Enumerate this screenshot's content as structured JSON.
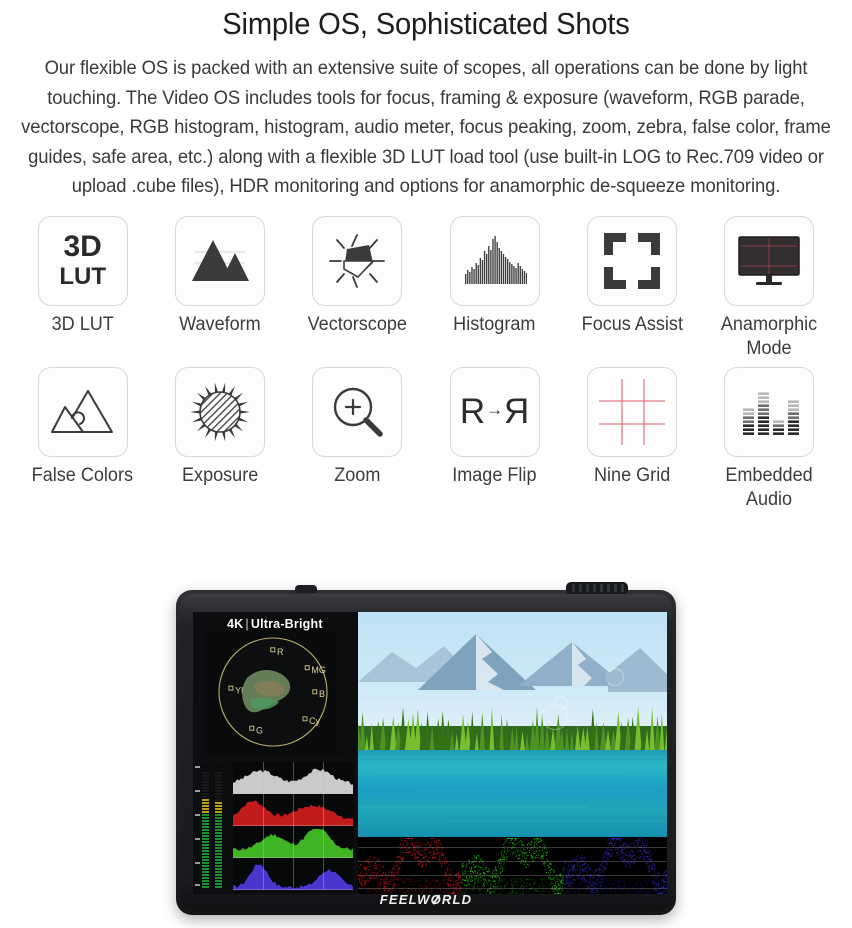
{
  "headline": "Simple OS, Sophisticated Shots",
  "intro": "Our flexible OS is packed with an extensive suite of scopes, all operations can be done by light touching. The Video OS includes tools for focus, framing & exposure (waveform, RGB parade, vectorscope, RGB histogram, histogram, audio meter, focus peaking, zoom, zebra, false color, frame guides, safe area, etc.) along with a flexible 3D LUT load tool (use built-in LOG to Rec.709 video or upload .cube files), HDR monitoring and options for anamorphic de-squeeze monitoring.",
  "features": [
    {
      "label": "3D LUT",
      "icon": "lut-3d-icon",
      "line1": "3D",
      "line2": "LUT"
    },
    {
      "label": "Waveform",
      "icon": "waveform-icon"
    },
    {
      "label": "Vectorscope",
      "icon": "vectorscope-icon"
    },
    {
      "label": "Histogram",
      "icon": "histogram-icon"
    },
    {
      "label": "Focus Assist",
      "icon": "focus-assist-icon"
    },
    {
      "label": "Anamorphic Mode",
      "icon": "anamorphic-monitor-icon"
    },
    {
      "label": "False Colors",
      "icon": "false-colors-icon"
    },
    {
      "label": "Exposure",
      "icon": "exposure-sun-icon"
    },
    {
      "label": "Zoom",
      "icon": "zoom-magnifier-icon"
    },
    {
      "label": "Image Flip",
      "icon": "image-flip-icon",
      "glyph_left": "R",
      "glyph_arrow": "→",
      "glyph_right": "R"
    },
    {
      "label": "Nine Grid",
      "icon": "nine-grid-icon"
    },
    {
      "label": "Embedded Audio",
      "icon": "embedded-audio-icon"
    }
  ],
  "monitor": {
    "overlay_title": "4K",
    "overlay_separator": "|",
    "overlay_subtitle": "Ultra-Bright",
    "brand_pre": "FEELW",
    "brand_o": "O",
    "brand_post": "RLD",
    "vectorscope_targets": [
      "R",
      "MG",
      "B",
      "Cy",
      "G",
      "Yl"
    ],
    "scopes": [
      "vectorscope",
      "audio-meter",
      "luma-histogram",
      "red-histogram",
      "green-histogram",
      "blue-histogram",
      "rgb-parade"
    ]
  },
  "colors": {
    "tile_border": "#d8d8d8",
    "text": "#3a3a3a",
    "heading": "#1d1d1d",
    "grid_red": "#e89aa0",
    "parade_red": "#e01818",
    "parade_green": "#25d81c",
    "parade_blue": "#3a2fe0"
  }
}
